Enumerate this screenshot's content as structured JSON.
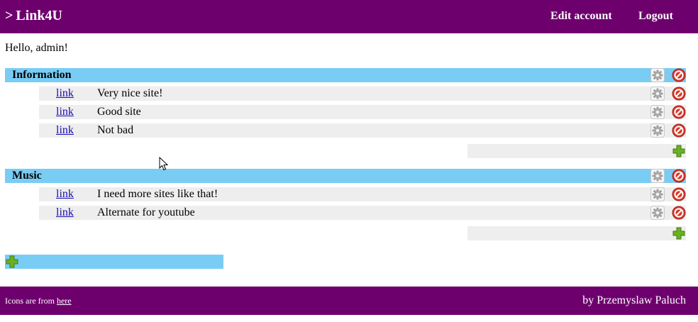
{
  "header": {
    "brand_arrow": ">",
    "brand_name": "Link4U",
    "edit_account": "Edit account",
    "logout": "Logout"
  },
  "greeting": "Hello, admin!",
  "categories": [
    {
      "title": "Information",
      "links": [
        {
          "link": "link",
          "desc": "Very nice site!"
        },
        {
          "link": "link",
          "desc": "Good site"
        },
        {
          "link": "link",
          "desc": "Not bad"
        }
      ]
    },
    {
      "title": "Music",
      "links": [
        {
          "link": "link",
          "desc": "I need more sites like that!"
        },
        {
          "link": "link",
          "desc": "Alternate for youtube"
        }
      ]
    }
  ],
  "footer": {
    "credit_prefix": "Icons are from",
    "credit_link": "here",
    "author": "by Przemyslaw Paluch"
  },
  "colors": {
    "header_bg": "#6e006e",
    "category_bg": "#79cdf5",
    "row_bg": "#eeeeee",
    "delete_red": "#d9392b",
    "add_green": "#6ab023"
  },
  "icons": {
    "edit": "gear-icon",
    "delete": "delete-icon",
    "add": "plus-icon"
  }
}
